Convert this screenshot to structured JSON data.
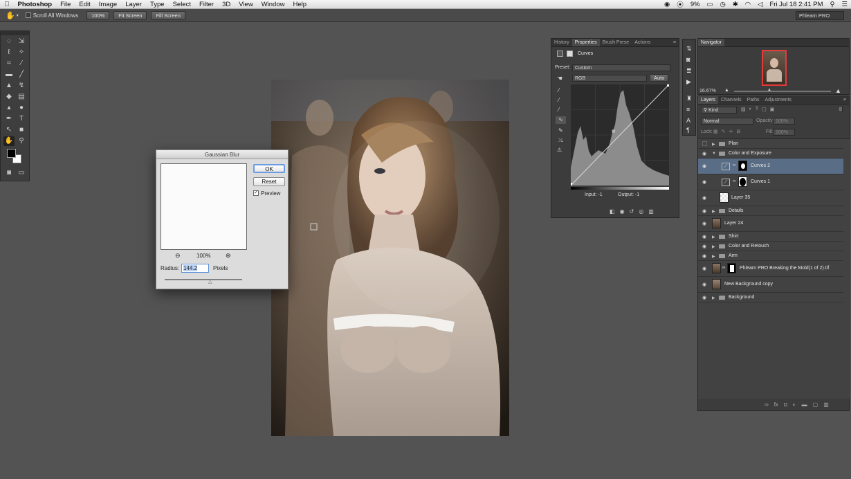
{
  "menubar": {
    "apple": "",
    "app": "Photoshop",
    "items": [
      "File",
      "Edit",
      "Image",
      "Layer",
      "Type",
      "Select",
      "Filter",
      "3D",
      "View",
      "Window",
      "Help"
    ],
    "battery": "9%",
    "clock": "Fri Jul 18  2:41 PM"
  },
  "options": {
    "scroll_all": "Scroll All Windows",
    "zoom100": "100%",
    "fit": "Fit Screen",
    "fill": "Fill Screen",
    "workspace": "Phlearn PRO"
  },
  "gaussian": {
    "title": "Gaussian Blur",
    "ok": "OK",
    "reset": "Reset",
    "preview": "Preview",
    "zoom": "100%",
    "radius_label": "Radius:",
    "radius_value": "144.2",
    "unit": "Pixels",
    "slider_level": 0.59
  },
  "properties": {
    "tabs": [
      "History",
      "Properties",
      "Brush Prese",
      "Actions"
    ],
    "active_tab": "Properties",
    "panel_title": "Curves",
    "preset_label": "Preset:",
    "preset_value": "Custom",
    "channel": "RGB",
    "auto": "Auto",
    "input": "Input: -1",
    "output": "Output: -1"
  },
  "navigator": {
    "title": "Navigator",
    "zoom": "16.67%"
  },
  "layers": {
    "tabs": [
      "Layers",
      "Channels",
      "Paths",
      "Adjustments"
    ],
    "kind": "Kind",
    "blend": "Normal",
    "opacity_label": "Opacity:",
    "opacity": "100%",
    "lock_label": "Lock:",
    "fill_label": "Fill:",
    "fill": "100%",
    "items": [
      {
        "name": "Plan",
        "type": "group",
        "visible": false
      },
      {
        "name": "Color and Exposure",
        "type": "group-open",
        "visible": true
      },
      {
        "name": "Curves 2",
        "type": "adjust",
        "visible": true,
        "selected": true
      },
      {
        "name": "Curves 1",
        "type": "adjust",
        "visible": true
      },
      {
        "name": "Layer 35",
        "type": "pixel",
        "visible": true
      },
      {
        "name": "Details",
        "type": "group",
        "visible": true
      },
      {
        "name": "Layer 24",
        "type": "photo",
        "visible": true
      },
      {
        "name": "Shirt",
        "type": "group",
        "visible": true
      },
      {
        "name": "Color and Retouch",
        "type": "group",
        "visible": true
      },
      {
        "name": "Arm",
        "type": "group",
        "visible": true
      },
      {
        "name": "Phlearn PRO Breaking the Mold(1 of 2).tif",
        "type": "photo-mask",
        "visible": true
      },
      {
        "name": "New Background copy",
        "type": "photo",
        "visible": true
      },
      {
        "name": "Background",
        "type": "group",
        "visible": true
      }
    ]
  },
  "colors": {
    "selected_layer": "#5a6d86",
    "accent": "#5a8fd6"
  }
}
